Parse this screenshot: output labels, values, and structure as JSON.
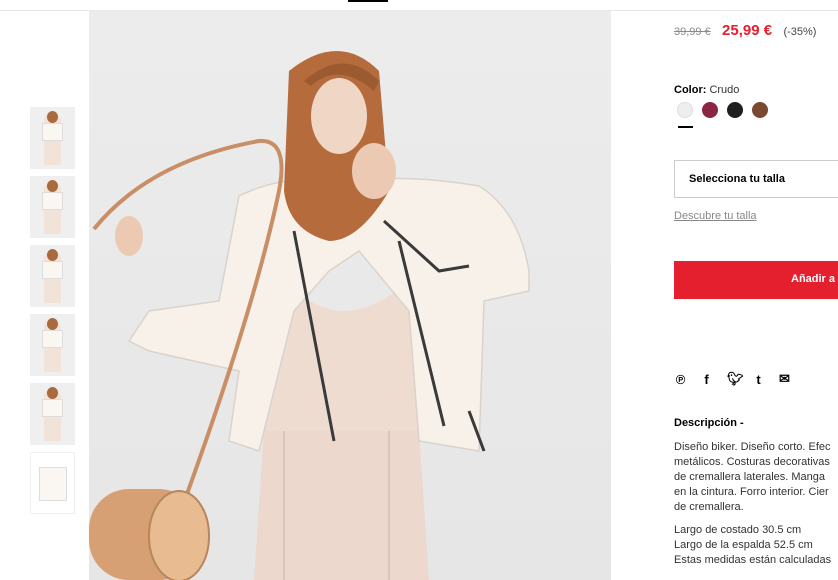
{
  "gallery": {
    "thumbnail_count": 6
  },
  "product": {
    "old_price": "39,99 €",
    "price": "25,99 €",
    "discount": "(-35%)",
    "color_label": "Color:",
    "color_value": "Crudo",
    "swatches": [
      "#eeeeee",
      "#8b2543",
      "#1f1f1f",
      "#7a4a30"
    ],
    "size_select_label": "Selecciona tu talla",
    "size_guide_link": "Descubre tu talla",
    "add_button_label": "Añadir a",
    "share_icons": [
      "pinterest-icon",
      "facebook-icon",
      "twitter-icon",
      "tumblr-icon",
      "email-icon"
    ]
  },
  "description": {
    "title": "Descripción -",
    "lines": [
      "Diseño biker. Diseño corto. Efec",
      "metálicos. Costuras decorativas",
      "de cremallera laterales. Manga",
      "en la cintura. Forro interior. Cier",
      "de cremallera."
    ],
    "measures": [
      "Largo de costado 30.5 cm",
      "Largo de la espalda 52.5 cm",
      "Estas medidas están calculadas"
    ]
  },
  "colors": {
    "accent": "#e5202e",
    "text": "#000000"
  }
}
